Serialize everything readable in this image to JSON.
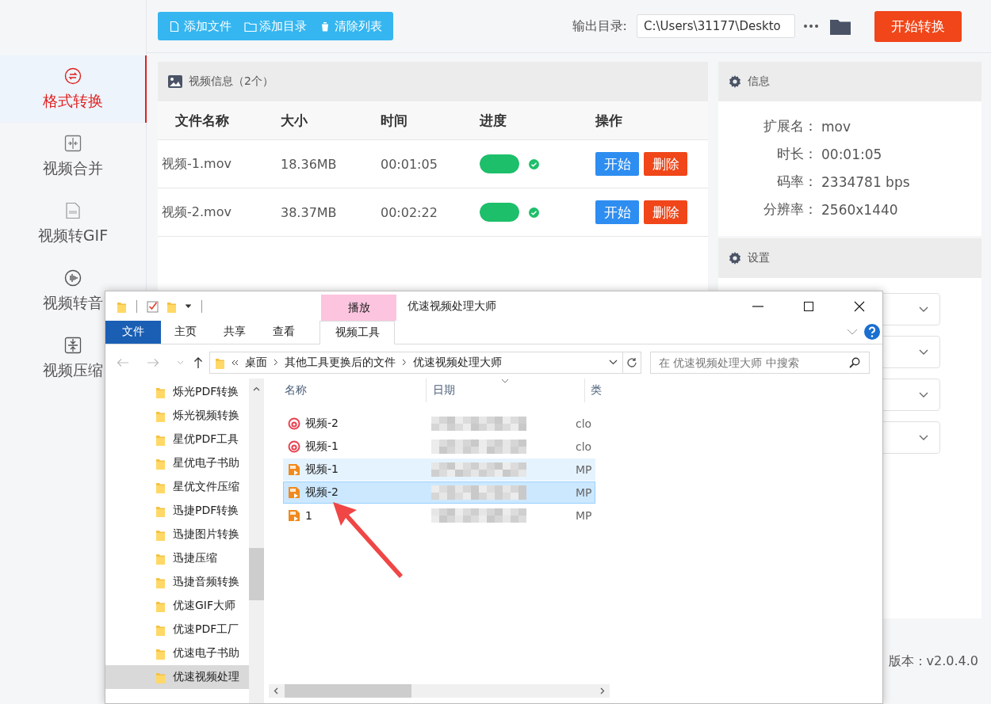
{
  "app": {
    "sidebar": [
      {
        "label": "格式转换",
        "selected": true,
        "kind": "convert"
      },
      {
        "label": "视频合并",
        "selected": false,
        "kind": "merge"
      },
      {
        "label": "视频转GIF",
        "selected": false,
        "kind": "gif"
      },
      {
        "label": "视频转音",
        "selected": false,
        "kind": "audio"
      },
      {
        "label": "视频压缩",
        "selected": false,
        "kind": "compress"
      }
    ],
    "toolbar_buttons": [
      {
        "label": "添加文件",
        "kind": "file"
      },
      {
        "label": "添加目录",
        "kind": "folder"
      },
      {
        "label": "清除列表",
        "kind": "trash"
      }
    ],
    "output": {
      "label": "输出目录:",
      "value": "C:\\Users\\31177\\Deskto"
    },
    "start_button": "开始转换",
    "video_panel": {
      "title": "视频信息（2个）",
      "columns": [
        "文件名称",
        "大小",
        "时间",
        "进度",
        "操作"
      ],
      "rows": [
        {
          "name": "视频-1.mov",
          "size": "18.36MB",
          "duration": "00:01:05",
          "level": 1,
          "done": true,
          "actions": [
            {
              "label": "开始",
              "kind": "start"
            },
            {
              "label": "删除",
              "kind": "delete"
            }
          ]
        },
        {
          "name": "视频-2.mov",
          "size": "38.37MB",
          "duration": "00:02:22",
          "level": 1,
          "done": true,
          "actions": [
            {
              "label": "开始",
              "kind": "start"
            },
            {
              "label": "删除",
              "kind": "delete"
            }
          ]
        }
      ]
    },
    "info_panel": {
      "title": "信息",
      "fields": [
        {
          "label": "扩展名：",
          "value": "mov"
        },
        {
          "label": "时长：",
          "value": "00:01:05"
        },
        {
          "label": "码率：",
          "value": "2334781 bps"
        },
        {
          "label": "分辨率：",
          "value": "2560x1440"
        }
      ]
    },
    "settings_panel": {
      "title": "设置",
      "selects": [
        {
          "kind": "dropdown"
        },
        {
          "kind": "dropdown"
        },
        {
          "kind": "dropdown"
        },
        {
          "kind": "dropdown"
        }
      ]
    },
    "version": "版本：v2.0.4.0"
  },
  "explorer": {
    "title": "优速视频处理大师",
    "context_tab": "播放",
    "ribbon_tabs": [
      {
        "label": "文件",
        "selected": false,
        "kind": "file"
      },
      {
        "label": "主页",
        "selected": false,
        "kind": "tab"
      },
      {
        "label": "共享",
        "selected": false,
        "kind": "tab"
      },
      {
        "label": "查看",
        "selected": false,
        "kind": "tab"
      },
      {
        "label": "视频工具",
        "selected": true,
        "kind": "tab"
      }
    ],
    "breadcrumb": [
      "桌面",
      "其他工具更换后的文件",
      "优速视频处理大师"
    ],
    "search": {
      "placeholder": "在 优速视频处理大师 中搜索"
    },
    "tree": [
      {
        "label": "烁光PDF转换",
        "selected": false
      },
      {
        "label": "烁光视频转换",
        "selected": false
      },
      {
        "label": "星优PDF工具",
        "selected": false
      },
      {
        "label": "星优电子书助",
        "selected": false
      },
      {
        "label": "星优文件压缩",
        "selected": false
      },
      {
        "label": "迅捷PDF转换",
        "selected": false
      },
      {
        "label": "迅捷图片转换",
        "selected": false
      },
      {
        "label": "迅捷压缩",
        "selected": false
      },
      {
        "label": "迅捷音频转换",
        "selected": false
      },
      {
        "label": "优速GIF大师",
        "selected": false
      },
      {
        "label": "优速PDF工厂",
        "selected": false
      },
      {
        "label": "优速电子书助",
        "selected": false
      },
      {
        "label": "优速视频处理",
        "selected": true
      }
    ],
    "columns": [
      "名称",
      "日期",
      "类"
    ],
    "files": [
      {
        "name": "视频-2",
        "type": "clo",
        "kind": "swirl",
        "selected": false,
        "hovered": false
      },
      {
        "name": "视频-1",
        "type": "clo",
        "kind": "swirl",
        "selected": false,
        "hovered": false
      },
      {
        "name": "视频-1",
        "type": "MP",
        "kind": "video",
        "selected": false,
        "hovered": true
      },
      {
        "name": "视频-2",
        "type": "MP",
        "kind": "video",
        "selected": true,
        "hovered": false
      },
      {
        "name": "1",
        "type": "MP",
        "kind": "video",
        "selected": false,
        "hovered": false
      }
    ]
  }
}
